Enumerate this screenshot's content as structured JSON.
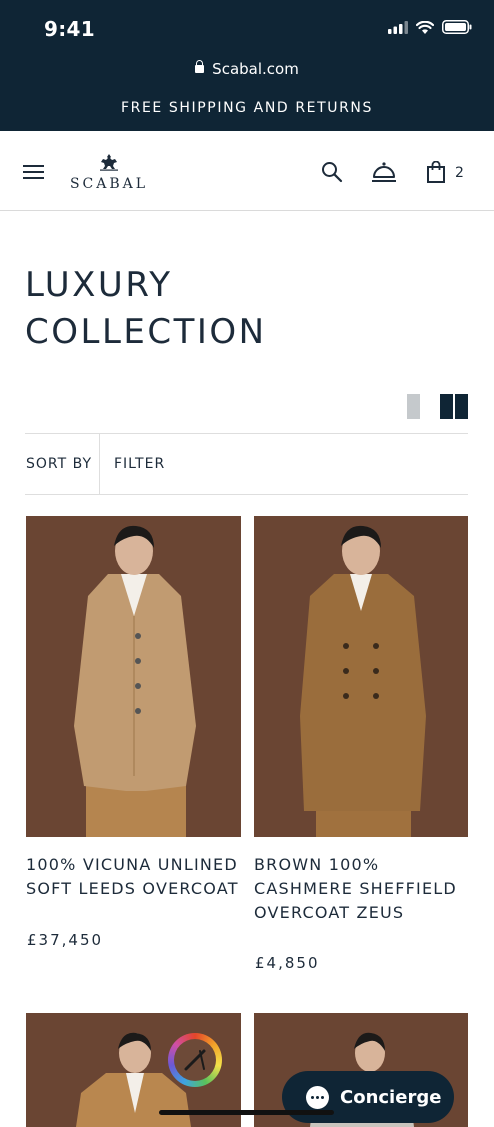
{
  "status_bar": {
    "time": "9:41"
  },
  "browser": {
    "url": "Scabal.com"
  },
  "promo": {
    "text": "FREE SHIPPING AND RETURNS"
  },
  "header": {
    "logo_text": "SCABAL",
    "cart_count": "2",
    "icons": [
      "menu-icon",
      "search-icon",
      "concierge-bell-icon",
      "shopping-bag-icon"
    ]
  },
  "page": {
    "title_line1": "LUXURY",
    "title_line2": "COLLECTION"
  },
  "toolbar": {
    "sort_label": "SORT BY",
    "filter_label": "FILTER",
    "view_modes": [
      "single-column",
      "two-column"
    ],
    "active_view": "two-column"
  },
  "products": [
    {
      "name": "100% VICUNA UNLINED SOFT LEEDS OVERCOAT",
      "price": "£37,450",
      "coat_color": "#c19b71"
    },
    {
      "name": "BROWN 100% CASHMERE SHEFFIELD OVERCOAT ZEUS",
      "price": "£4,850",
      "coat_color": "#9a6d3c"
    }
  ],
  "floating": {
    "concierge_label": "Concierge"
  },
  "colors": {
    "brand_dark": "#0f2535",
    "photo_bg": "#6a4533"
  }
}
